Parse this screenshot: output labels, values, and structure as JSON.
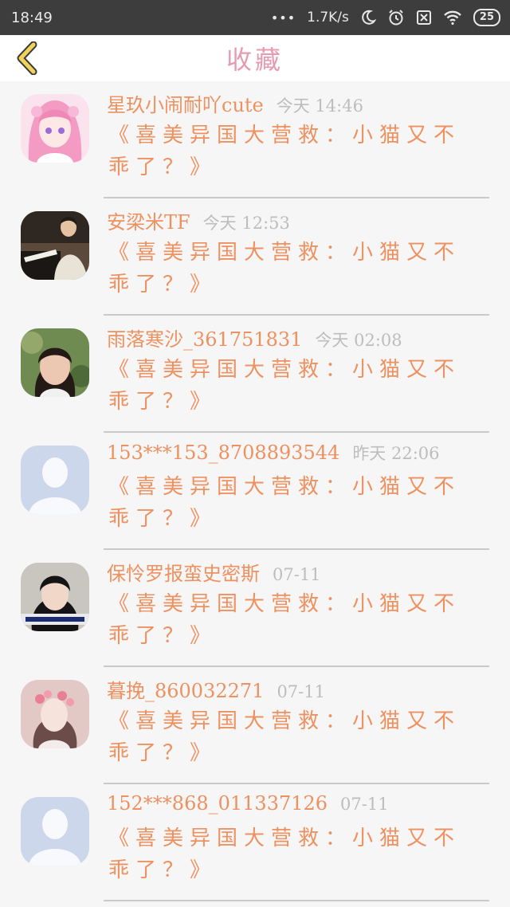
{
  "status_bar": {
    "time": "18:49",
    "dots": "•••",
    "speed": "1.7K/s",
    "battery": "25"
  },
  "header": {
    "title": "收藏",
    "back_icon": "chevron-left-icon"
  },
  "colors": {
    "accent_orange": "#ee9160",
    "title_pink": "#e79bb0",
    "back_yellow": "#f2d35a"
  },
  "items": [
    {
      "name": "星玖小闹耐吖cute",
      "time": "今天 14:46",
      "message": "《喜美异国大营救：小猫又不乖了？》",
      "avatar": "pink-anime-girl"
    },
    {
      "name": "安梁米TF",
      "time": "今天 12:53",
      "message": "《喜美异国大营救：小猫又不乖了？》",
      "avatar": "piano-player"
    },
    {
      "name": "雨落寒沙_361751831",
      "time": "今天 02:08",
      "message": "《喜美异国大营救：小猫又不乖了？》",
      "avatar": "girl-portrait"
    },
    {
      "name": "153***153_8708893544",
      "time": "昨天 22:06",
      "message": "《喜美异国大营救：小猫又不乖了？》",
      "avatar": "default-user"
    },
    {
      "name": "保怜罗报蛮史密斯",
      "time": "07-11",
      "message": "《喜美异国大营救：小猫又不乖了？》",
      "avatar": "girl-caption"
    },
    {
      "name": "暮挽_860032271",
      "time": "07-11",
      "message": "《喜美异国大营救：小猫又不乖了？》",
      "avatar": "girl-flowers"
    },
    {
      "name": "152***868_011337126",
      "time": "07-11",
      "message": "《喜美异国大营救：小猫又不乖了？》",
      "avatar": "default-user"
    }
  ]
}
